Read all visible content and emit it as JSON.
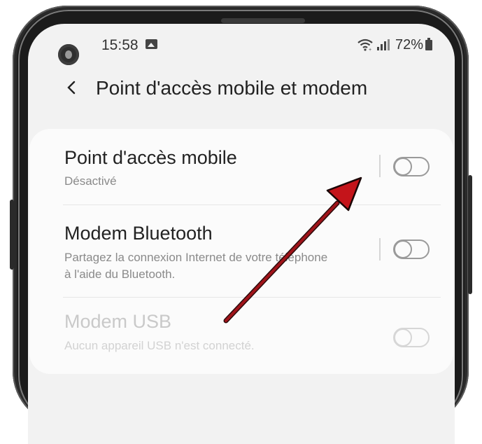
{
  "status_bar": {
    "time": "15:58",
    "battery": "72%",
    "icons": [
      "gallery-icon",
      "wifi-icon",
      "signal-icon",
      "battery-icon"
    ]
  },
  "header": {
    "back_icon": "chevron-left-icon",
    "title": "Point d'accès mobile et modem"
  },
  "settings": [
    {
      "title": "Point d'accès mobile",
      "subtitle": "Désactivé",
      "toggle_on": false,
      "enabled": true
    },
    {
      "title": "Modem Bluetooth",
      "subtitle": "Partagez la connexion Internet de votre téléphone à l'aide du Bluetooth.",
      "toggle_on": false,
      "enabled": true
    },
    {
      "title": "Modem USB",
      "subtitle": "Aucun appareil USB n'est connecté.",
      "toggle_on": false,
      "enabled": false
    }
  ],
  "colors": {
    "arrow": "#c4141a",
    "screen_bg": "#f2f2f2",
    "frame": "#1b1b1b"
  }
}
